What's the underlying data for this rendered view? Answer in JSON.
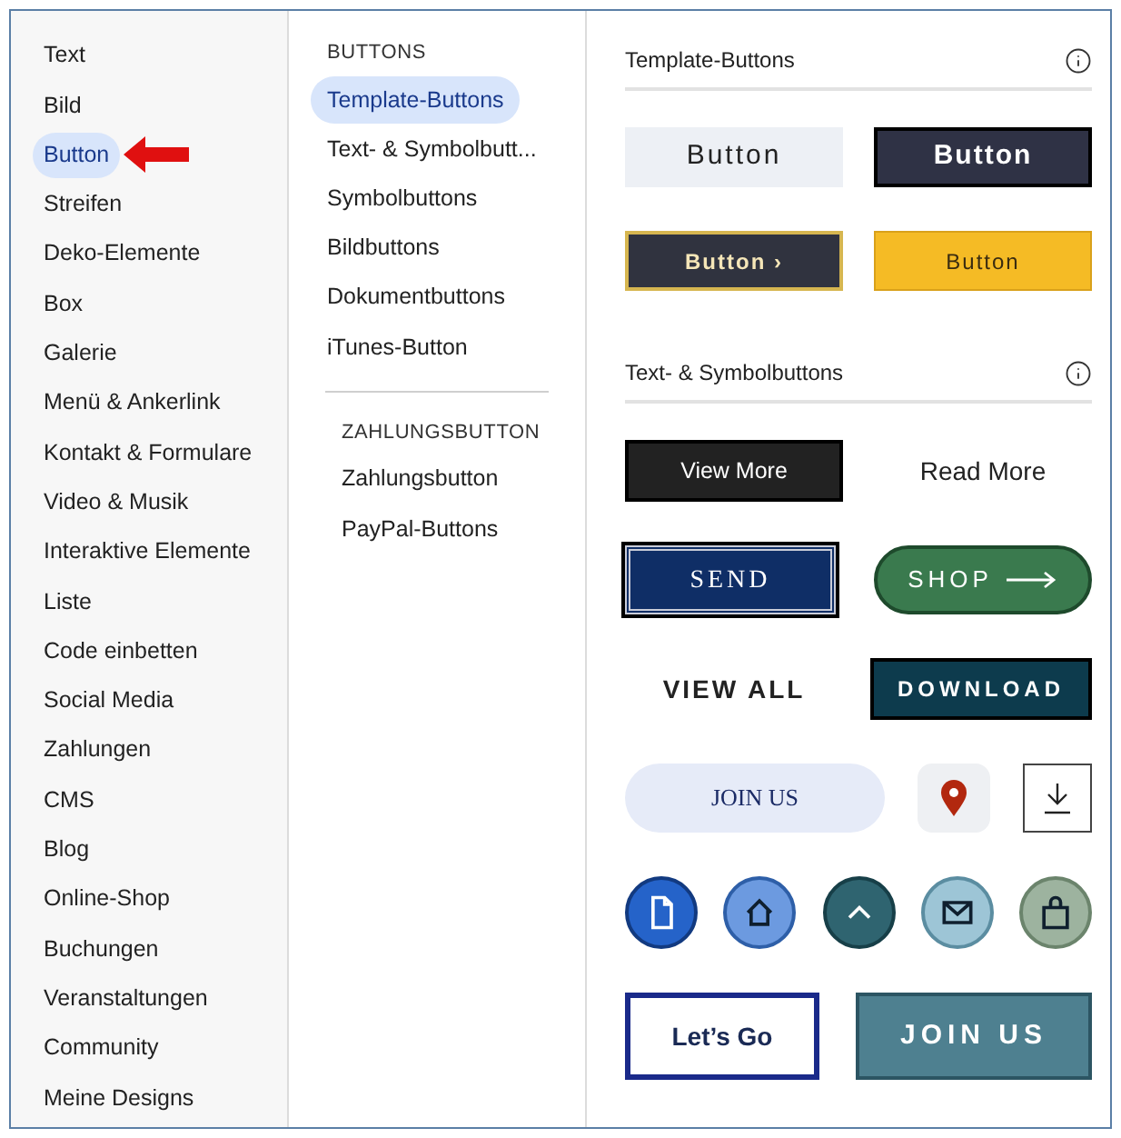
{
  "categories": [
    {
      "label": "Text",
      "selected": false
    },
    {
      "label": "Bild",
      "selected": false
    },
    {
      "label": "Button",
      "selected": true
    },
    {
      "label": "Streifen",
      "selected": false
    },
    {
      "label": "Deko-Elemente",
      "selected": false
    },
    {
      "label": "Box",
      "selected": false
    },
    {
      "label": "Galerie",
      "selected": false
    },
    {
      "label": "Menü & Ankerlink",
      "selected": false
    },
    {
      "label": "Kontakt & Formulare",
      "selected": false
    },
    {
      "label": "Video & Musik",
      "selected": false
    },
    {
      "label": "Interaktive Elemente",
      "selected": false
    },
    {
      "label": "Liste",
      "selected": false
    },
    {
      "label": "Code einbetten",
      "selected": false
    },
    {
      "label": "Social Media",
      "selected": false
    },
    {
      "label": "Zahlungen",
      "selected": false
    },
    {
      "label": "CMS",
      "selected": false
    },
    {
      "label": "Blog",
      "selected": false
    },
    {
      "label": "Online-Shop",
      "selected": false
    },
    {
      "label": "Buchungen",
      "selected": false
    },
    {
      "label": "Veranstaltungen",
      "selected": false
    },
    {
      "label": "Community",
      "selected": false
    },
    {
      "label": "Meine Designs",
      "selected": false
    }
  ],
  "subcategories": [
    {
      "title": "BUTTONS",
      "items": [
        {
          "label": "Template-Buttons",
          "selected": true
        },
        {
          "label": "Text- & Symbolbutt...",
          "selected": false
        },
        {
          "label": "Symbolbuttons",
          "selected": false
        },
        {
          "label": "Bildbuttons",
          "selected": false
        },
        {
          "label": "Dokumentbuttons",
          "selected": false
        },
        {
          "label": "iTunes-Button",
          "selected": false
        }
      ]
    },
    {
      "title": "ZAHLUNGSBUTTON",
      "items": [
        {
          "label": "Zahlungsbutton",
          "selected": false
        },
        {
          "label": "PayPal-Buttons",
          "selected": false
        }
      ]
    }
  ],
  "sections": [
    {
      "title": "Template-Buttons",
      "rows": [
        [
          {
            "kind": "light",
            "label": "Button"
          },
          {
            "kind": "dark",
            "label": "Button"
          }
        ],
        [
          {
            "kind": "dark-chevron",
            "label": "Button ›"
          },
          {
            "kind": "yellow",
            "label": "Button"
          }
        ]
      ]
    },
    {
      "title": "Text- & Symbolbuttons",
      "rows": [
        [
          {
            "kind": "black",
            "label": "View More"
          },
          {
            "kind": "plain",
            "label": "Read More"
          }
        ],
        [
          {
            "kind": "navy-serif",
            "label": "SEND"
          },
          {
            "kind": "green-pill",
            "label": "SHOP"
          }
        ],
        [
          {
            "kind": "caps-plain",
            "label": "VIEW ALL"
          },
          {
            "kind": "teal",
            "label": "DOWNLOAD"
          }
        ],
        [
          {
            "kind": "pill-light",
            "label": "JOIN US"
          },
          {
            "kind": "pin"
          },
          {
            "kind": "download"
          }
        ],
        [
          {
            "kind": "doc"
          },
          {
            "kind": "home"
          },
          {
            "kind": "up"
          },
          {
            "kind": "mail"
          },
          {
            "kind": "bag"
          }
        ],
        [
          {
            "kind": "outline",
            "label": "Let’s Go"
          },
          {
            "kind": "teal-wide",
            "label": "JOIN US"
          }
        ]
      ]
    }
  ]
}
